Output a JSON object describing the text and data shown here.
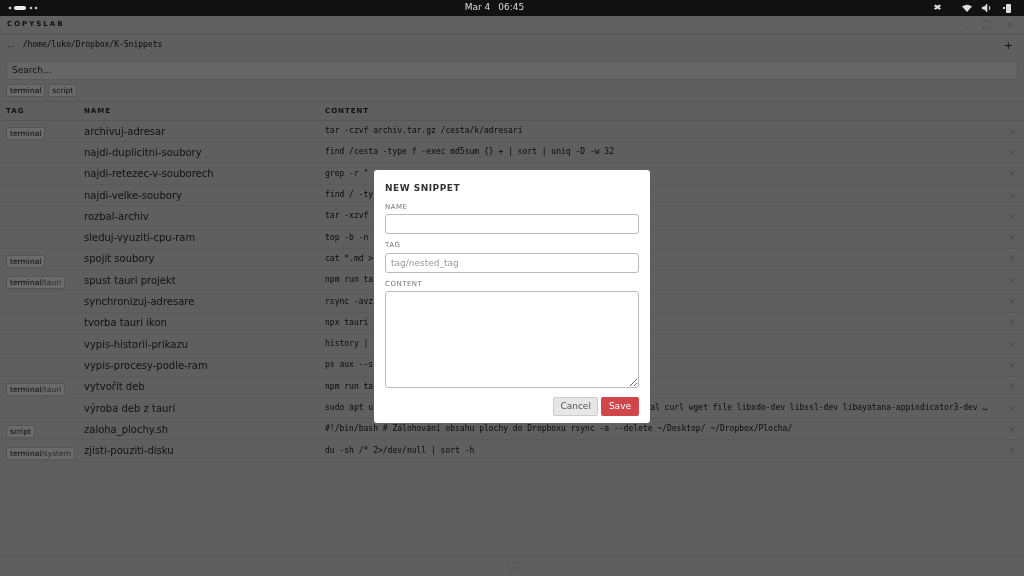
{
  "top_bar": {
    "date": "Mar 4",
    "time": "06:45"
  },
  "window": {
    "title": "COPYSLAB"
  },
  "path": {
    "ellipsis": "...",
    "text": "/home/luko/Dropbox/K-Snippets",
    "add": "+"
  },
  "search": {
    "placeholder": "Search..."
  },
  "filters": [
    "terminal",
    "script"
  ],
  "table": {
    "columns": [
      "TAG",
      "NAME",
      "CONTENT"
    ],
    "rows": [
      {
        "tag": "terminal",
        "name": "archivuj-adresar",
        "content": "tar -czvf archiv.tar.gz /cesta/k/adresari"
      },
      {
        "name": "najdi-duplicitni-soubory",
        "content": "find /cesta -type f -exec md5sum {} + | sort | uniq -D -w 32"
      },
      {
        "name": "najdi-retezec-v-souborech",
        "content": "grep -r \""
      },
      {
        "name": "najdi-velke-soubory",
        "content": "find / -ty"
      },
      {
        "name": "rozbal-archiv",
        "content": "tar -xzvf"
      },
      {
        "name": "sleduj-vyuziti-cpu-ram",
        "content": "top -b -n"
      },
      {
        "tag": "terminal",
        "name": "spojit soubory",
        "content": "cat *.md >"
      },
      {
        "tag": "terminal",
        "subtag": "/tauri",
        "name": "spust tauri projekt",
        "content": "npm run ta"
      },
      {
        "name": "synchronizuj-adresare",
        "content": "rsync -avz"
      },
      {
        "name": "tvorba tauri ikon",
        "content": "npx tauri"
      },
      {
        "name": "vypis-historii-prikazu",
        "content": "history |"
      },
      {
        "name": "vypis-procesy-podle-ram",
        "content": "ps aux --s"
      },
      {
        "tag": "terminal",
        "subtag": "/tauri",
        "name": "vytvořit deb",
        "content": "npm run ta"
      },
      {
        "name": "výroba deb z tauri",
        "content": "sudo apt u",
        "content_tail": "al curl wget file libxdo-dev libssl-dev libayatana-appindicator3-dev …"
      },
      {
        "tag": "script",
        "name": "zaloha_plochy.sh",
        "content": "#!/bin/bash # Zálohování obsahu plochy do Dropboxu rsync -a --delete ~/Desktop/ ~/Dropbox/Plocha/"
      },
      {
        "tag": "terminal",
        "subtag": "/system",
        "name": "zjisti-pouziti-disku",
        "content": "du -sh /* 2>/dev/null | sort -h"
      }
    ]
  },
  "dialog": {
    "title": "NEW SNIPPET",
    "fields": [
      {
        "label": "NAME",
        "kind": "input"
      },
      {
        "label": "TAG",
        "kind": "input",
        "placeholder": "tag/nested_tag"
      },
      {
        "label": "CONTENT",
        "kind": "textarea"
      }
    ],
    "buttons": [
      {
        "label": "Cancel",
        "kind": "secondary"
      },
      {
        "label": "Save",
        "kind": "primary"
      }
    ]
  }
}
